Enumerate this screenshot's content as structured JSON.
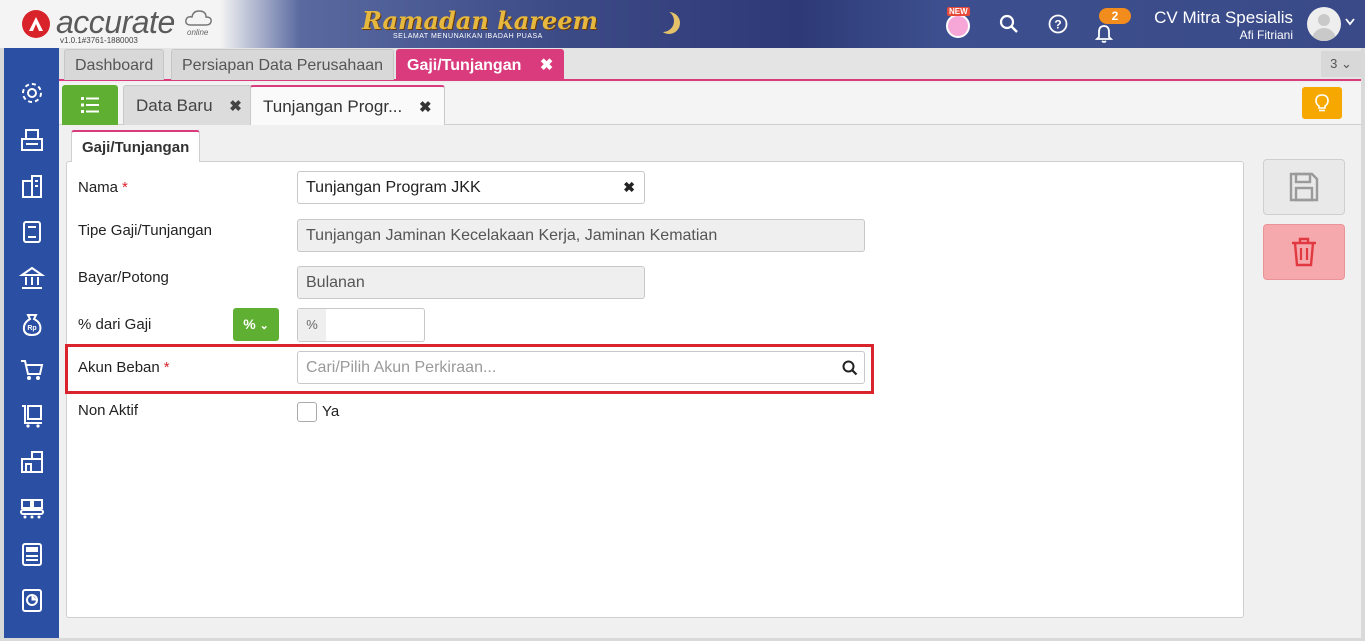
{
  "header": {
    "logo_text": "accurate",
    "logo_online": "online",
    "version": "v1.0.1#3761-1880003",
    "banner_title": "Ramadan kareem",
    "banner_subtitle": "SELAMAT MENUNAIKAN IBADAH PUASA",
    "new_badge": "NEW",
    "notification_count": "2",
    "company_name": "CV Mitra Spesialis",
    "user_name": "Afi Fitriani"
  },
  "sidebar": {
    "items": [
      {
        "icon": "gear-icon"
      },
      {
        "icon": "fax-icon"
      },
      {
        "icon": "building-icon"
      },
      {
        "icon": "ledger-icon"
      },
      {
        "icon": "bank-icon"
      },
      {
        "icon": "money-bag-icon"
      },
      {
        "icon": "cart-icon"
      },
      {
        "icon": "purchase-icon"
      },
      {
        "icon": "warehouse-icon"
      },
      {
        "icon": "conveyor-icon"
      },
      {
        "icon": "tax-icon"
      },
      {
        "icon": "report-icon"
      }
    ]
  },
  "module_tabs": {
    "tabs": [
      {
        "label": "Dashboard"
      },
      {
        "label": "Persiapan Data Perusahaan"
      },
      {
        "label": "Gaji/Tunjangan",
        "close": "✖"
      }
    ],
    "count": "3"
  },
  "record_tabs": {
    "tabs": [
      {
        "label": "Data Baru",
        "close": "✖"
      },
      {
        "label": "Tunjangan Progr...",
        "close": "✖"
      }
    ]
  },
  "form": {
    "section_tab": "Gaji/Tunjangan",
    "fields": {
      "nama": {
        "label": "Nama",
        "value": "Tunjangan Program JKK",
        "required": "*",
        "clear": "✖"
      },
      "tipe": {
        "label": "Tipe Gaji/Tunjangan",
        "value": "Tunjangan Jaminan Kecelakaan Kerja, Jaminan Kematian"
      },
      "bayar": {
        "label": "Bayar/Potong",
        "value": "Bulanan"
      },
      "persen": {
        "label": "% dari Gaji",
        "button": "%",
        "addon": "%",
        "value": ""
      },
      "akun": {
        "label": "Akun Beban",
        "required": "*",
        "placeholder": "Cari/Pilih Akun Perkiraan..."
      },
      "nonaktif": {
        "label": "Non Aktif",
        "checkbox_label": "Ya",
        "checked": false
      }
    }
  },
  "colors": {
    "sidebar": "#2a4fa3",
    "accent": "#d93b7c",
    "green": "#5fb032",
    "highlight": "#d9232d",
    "warning": "#f6a800"
  }
}
